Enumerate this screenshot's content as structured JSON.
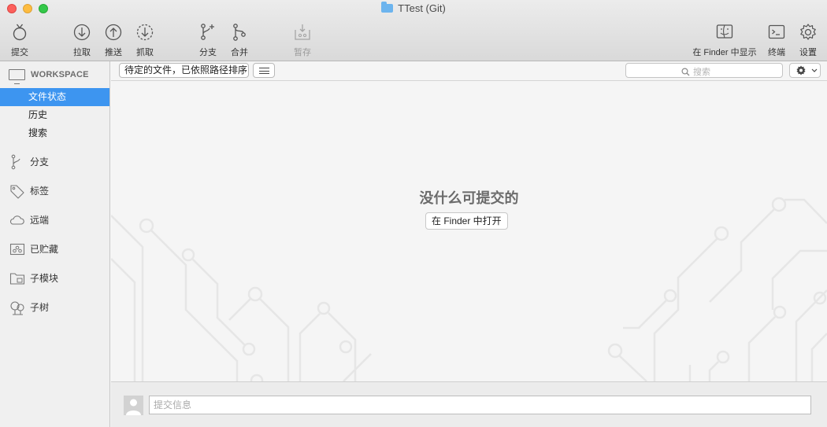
{
  "window": {
    "title": "TTest (Git)"
  },
  "toolbar": {
    "commit": "提交",
    "pull": "拉取",
    "push": "推送",
    "fetch": "抓取",
    "branch": "分支",
    "merge": "合并",
    "stash": "暂存",
    "show_in_finder": "在 Finder 中显示",
    "terminal": "终端",
    "settings": "设置"
  },
  "sidebar": {
    "workspace_title": "WORKSPACE",
    "workspace_items": [
      "文件状态",
      "历史",
      "搜索"
    ],
    "selected_item": "文件状态",
    "sections": [
      "分支",
      "标签",
      "远端",
      "已贮藏",
      "子模块",
      "子树"
    ]
  },
  "filterbar": {
    "sort_select": "待定的文件，已依照路径排序",
    "search_placeholder": "搜索"
  },
  "main": {
    "empty_title": "没什么可提交的",
    "open_in_finder": "在 Finder 中打开"
  },
  "commit": {
    "placeholder": "提交信息"
  },
  "colors": {
    "selection": "#3d95f0",
    "close": "#fc605c",
    "minimize": "#fdbc40",
    "maximize": "#34c84a"
  }
}
